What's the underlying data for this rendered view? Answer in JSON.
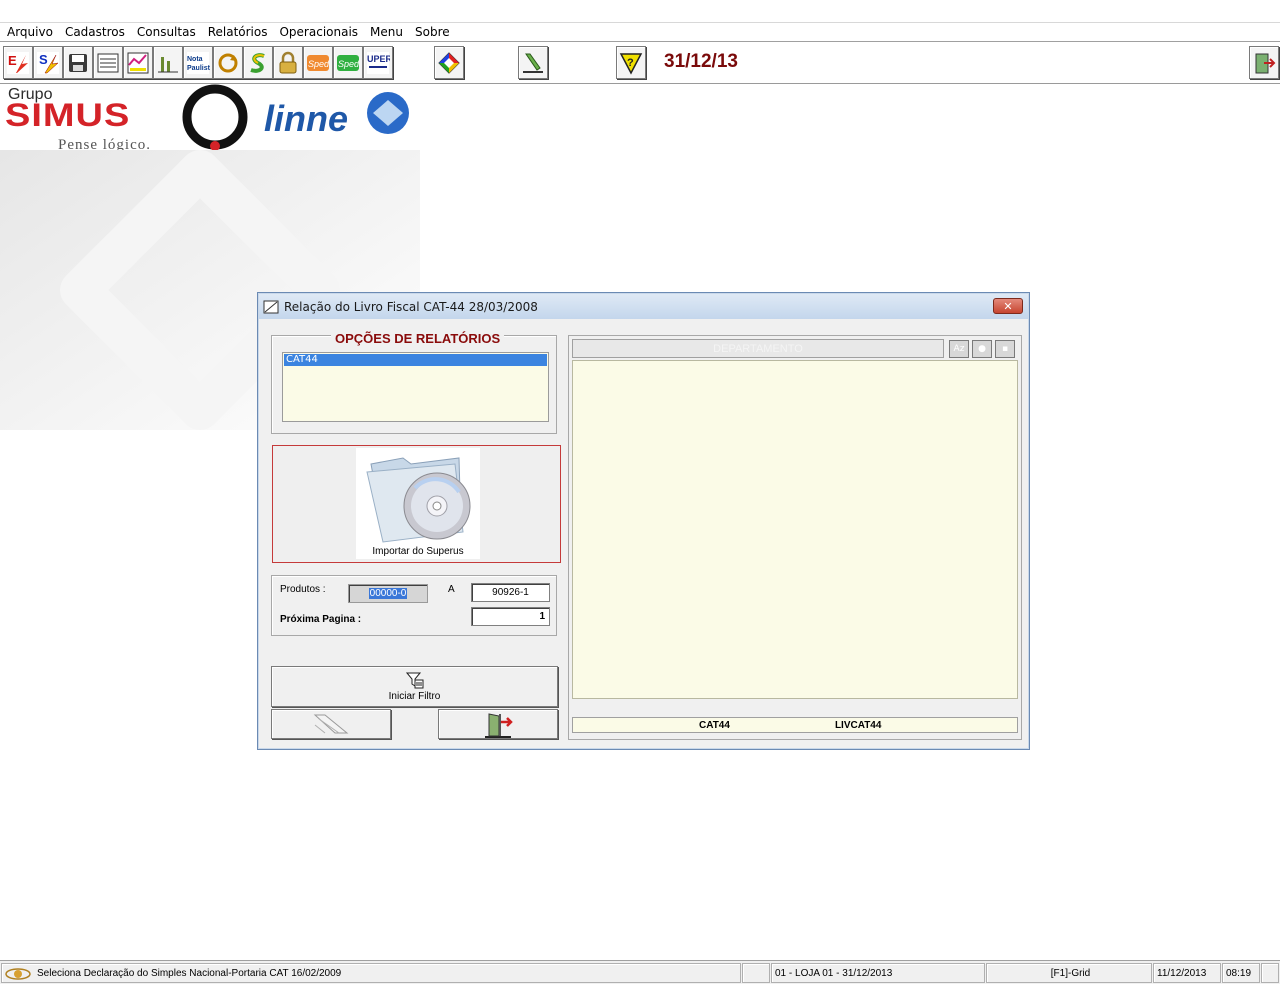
{
  "menubar": {
    "items": [
      "Arquivo",
      "Cadastros",
      "Consultas",
      "Relatórios",
      "Operacionais",
      "Menu",
      "Sobre"
    ]
  },
  "toolbar": {
    "date": "31/12/13",
    "icons": [
      "efd-icon",
      "sintegra-icon",
      "save-disk-icon",
      "report-icon",
      "chart-icon",
      "stats-icon",
      "nota-paulista-icon",
      "refresh-icon",
      "s-icon",
      "lock-icon",
      "sped-icon",
      "sped-2-icon",
      "superus-icon",
      "diamond-icon",
      "tool-icon",
      "help-icon",
      "exit-icon"
    ]
  },
  "logo": {
    "grupo": "Grupo",
    "simus": "SIMUS",
    "slogan": "Pense lógico.",
    "linner": "linne"
  },
  "dialog": {
    "title": "Relação do Livro Fiscal CAT-44 28/03/2008",
    "options_title": "OPÇÕES DE RELATÓRIOS",
    "options": [
      "CAT44"
    ],
    "import_label": "Importar do Superus",
    "produtos_label": "Produtos :",
    "produtos_from": "00000-0",
    "a_label": "A",
    "produtos_to": "90926-1",
    "proxima_label": "Próxima Pagina :",
    "proxima_value": "1",
    "filter_label": "Iniciar Filtro",
    "grid_header": "DEPARTAMENTO",
    "footer_left": "CAT44",
    "footer_right": "LIVCAT44"
  },
  "statusbar": {
    "message": "Seleciona Declaração do Simples Nacional-Portaria CAT 16/02/2009",
    "store": "01 - LOJA 01 - 31/12/2013",
    "hint": "[F1]-Grid",
    "date": "11/12/2013",
    "time": "08:19"
  }
}
